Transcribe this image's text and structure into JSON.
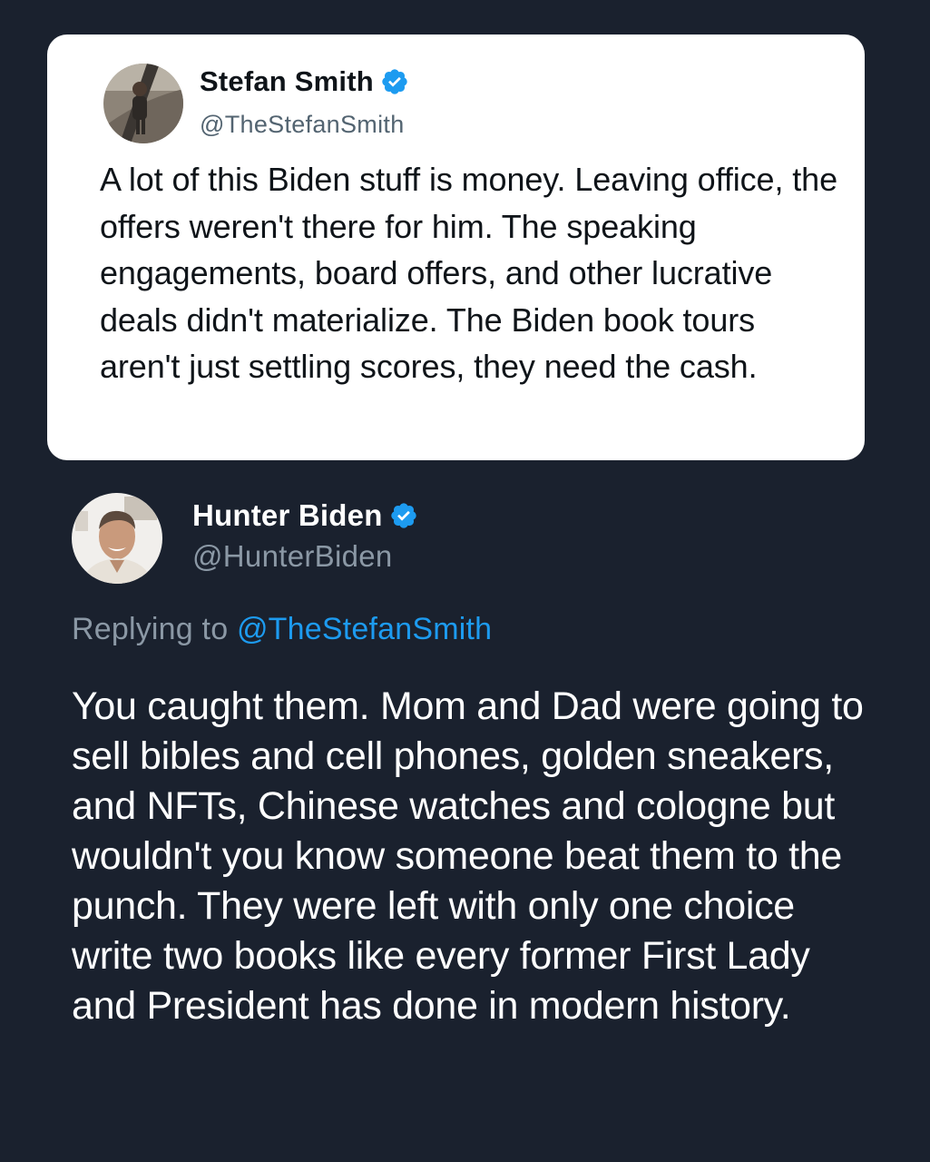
{
  "colors": {
    "background": "#1a212e",
    "card": "#ffffff",
    "verified_badge": "#1d9bf0",
    "link": "#1d9bf0",
    "secondary_text": "#8b98a5"
  },
  "quoted_post": {
    "author_name": "Stefan Smith",
    "author_handle": "@TheStefanSmith",
    "verified": true,
    "avatar_icon": "profile-photo",
    "text": "A lot of this Biden stuff is money. Leaving office, the offers weren't there for him. The speaking engagements, board offers, and other lucrative deals didn't materialize. The Biden book tours aren't just settling scores, they need the cash."
  },
  "reply_post": {
    "author_name": "Hunter Biden",
    "author_handle": "@HunterBiden",
    "verified": true,
    "avatar_icon": "profile-photo",
    "replying_prefix": "Replying to",
    "replying_to": "@TheStefanSmith",
    "text": "You caught them. Mom and Dad were going to sell bibles and cell phones, golden sneakers, and NFTs, Chinese watches and cologne but wouldn't you know someone beat them to the punch. They were left with only one choice write two books like every former First Lady and President has done in modern history."
  }
}
